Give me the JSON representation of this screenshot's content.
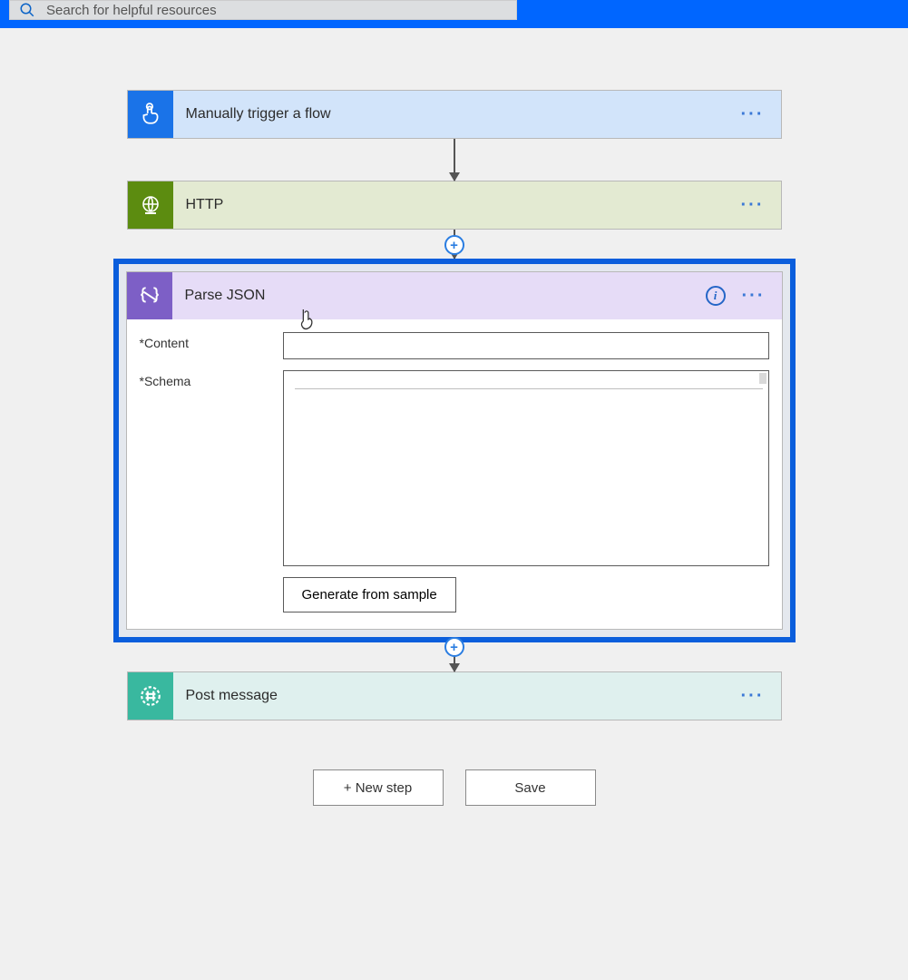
{
  "search": {
    "placeholder": "Search for helpful resources"
  },
  "flow": {
    "trigger": {
      "title": "Manually trigger a flow"
    },
    "http": {
      "title": "HTTP"
    },
    "parse": {
      "title": "Parse JSON",
      "fields": {
        "content_label": "Content",
        "schema_label": "Schema",
        "required_marker": "*"
      },
      "generate_button": "Generate from sample"
    },
    "post": {
      "title": "Post message"
    }
  },
  "buttons": {
    "new_step": "+ New step",
    "save": "Save"
  },
  "misc": {
    "ellipsis": "···",
    "info_glyph": "i",
    "plus": "+"
  }
}
